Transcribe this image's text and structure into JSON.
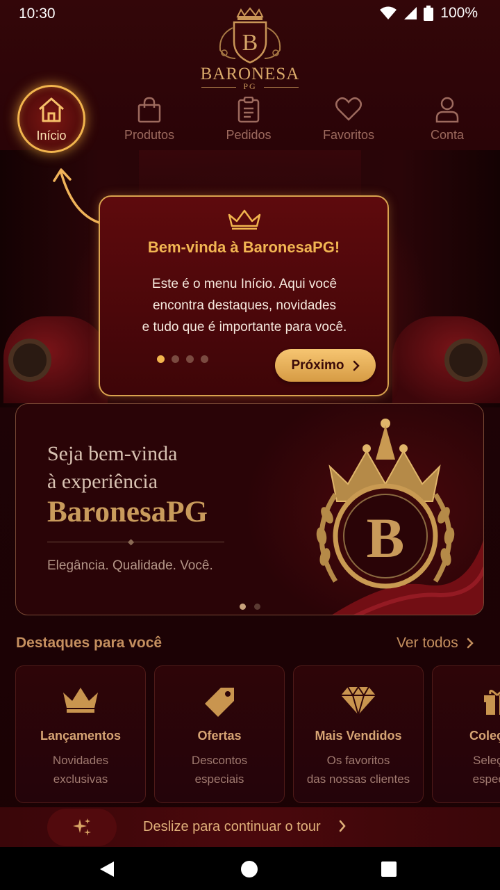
{
  "status_bar": {
    "time": "10:30",
    "battery": "100%"
  },
  "brand": {
    "letter": "B",
    "name": "BARONESA",
    "sub": "PG"
  },
  "nav": {
    "items": [
      {
        "label": "Início",
        "icon": "home-icon",
        "active": true
      },
      {
        "label": "Produtos",
        "icon": "shopping-bag-icon"
      },
      {
        "label": "Pedidos",
        "icon": "clipboard-icon"
      },
      {
        "label": "Favoritos",
        "icon": "heart-icon"
      },
      {
        "label": "Conta",
        "icon": "user-icon"
      }
    ]
  },
  "tooltip": {
    "title": "Bem-vinda à BaronesaPG!",
    "body_lines": [
      "Este é o menu Início. Aqui você",
      "encontra destaques, novidades",
      "e tudo que é importante para você."
    ],
    "step": 1,
    "total_steps": 4,
    "next_label": "Próximo"
  },
  "banner": {
    "line1": "Seja bem-vinda",
    "line2": "à experiência",
    "brand": "BaronesaPG",
    "tagline": "Elegância. Qualidade. Você.",
    "emblem_letter": "B",
    "slide": 1,
    "total_slides": 2
  },
  "highlights": {
    "title": "Destaques para você",
    "see_all": "Ver todos",
    "cards": [
      {
        "title": "Lançamentos",
        "desc_lines": [
          "Novidades",
          "exclusivas"
        ],
        "icon": "crown-icon"
      },
      {
        "title": "Ofertas",
        "desc_lines": [
          "Descontos",
          "especiais"
        ],
        "icon": "tag-icon"
      },
      {
        "title": "Mais Vendidos",
        "desc_lines": [
          "Os favoritos",
          "das nossas clientes"
        ],
        "icon": "diamond-icon"
      },
      {
        "title": "Coleções",
        "desc_lines": [
          "Seleções",
          "especiais"
        ],
        "icon": "gift-icon"
      }
    ]
  },
  "tour_strip": {
    "text": "Deslize para continuar o tour"
  },
  "colors": {
    "gold": "#f2b54e",
    "wine": "#2a0407",
    "accent_text": "#c58f5f"
  }
}
